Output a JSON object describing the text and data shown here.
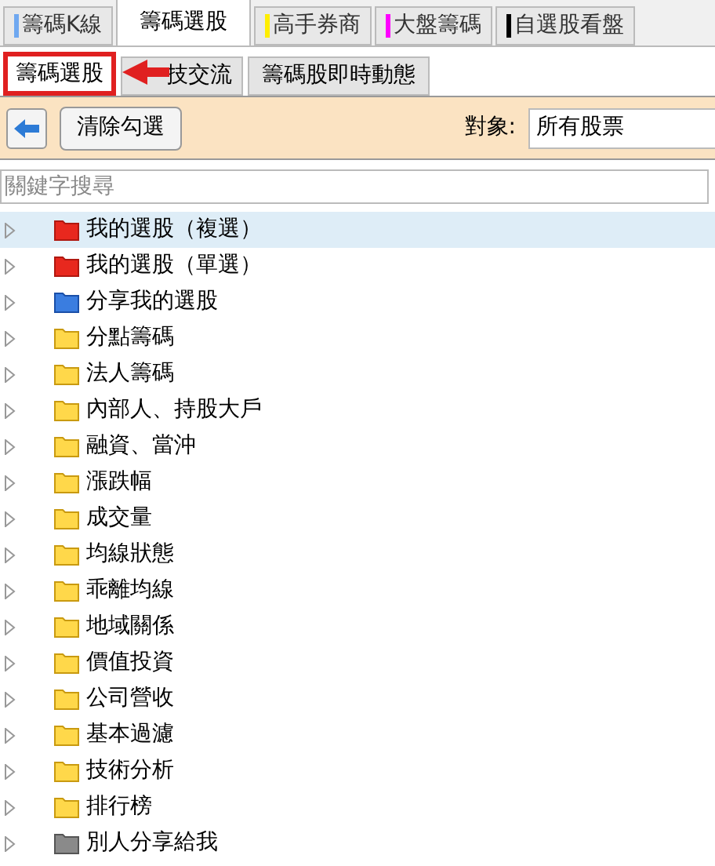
{
  "tabs": [
    {
      "label": "籌碼K線",
      "selected": false,
      "color": "#6fa8f0"
    },
    {
      "label": "籌碼選股",
      "selected": true
    },
    {
      "label": "高手券商",
      "selected": false,
      "color": "#ffee00"
    },
    {
      "label": "大盤籌碼",
      "selected": false,
      "color": "#ff00ff"
    },
    {
      "label": "自選股看盤",
      "selected": false,
      "color": "#000000"
    }
  ],
  "sub_tabs": [
    {
      "label": "籌碼選股",
      "selected": true
    },
    {
      "label": "技交流",
      "selected": false
    },
    {
      "label": "籌碼股即時動態",
      "selected": false
    }
  ],
  "toolbar": {
    "clear_button": "清除勾選",
    "target_label": "對象:",
    "target_value": "所有股票"
  },
  "search": {
    "placeholder": "關鍵字搜尋"
  },
  "tree": [
    {
      "label": "我的選股（複選）",
      "kind": "red",
      "selected": true
    },
    {
      "label": "我的選股（單選）",
      "kind": "red",
      "selected": false
    },
    {
      "label": "分享我的選股",
      "kind": "blue",
      "selected": false
    },
    {
      "label": "分點籌碼",
      "kind": "yellow",
      "selected": false
    },
    {
      "label": "法人籌碼",
      "kind": "yellow",
      "selected": false
    },
    {
      "label": "內部人、持股大戶",
      "kind": "yellow",
      "selected": false
    },
    {
      "label": "融資、當沖",
      "kind": "yellow",
      "selected": false
    },
    {
      "label": "漲跌幅",
      "kind": "yellow",
      "selected": false
    },
    {
      "label": "成交量",
      "kind": "yellow",
      "selected": false
    },
    {
      "label": "均線狀態",
      "kind": "yellow",
      "selected": false
    },
    {
      "label": "乖離均線",
      "kind": "yellow",
      "selected": false
    },
    {
      "label": "地域關係",
      "kind": "yellow",
      "selected": false
    },
    {
      "label": "價值投資",
      "kind": "yellow",
      "selected": false
    },
    {
      "label": "公司營收",
      "kind": "yellow",
      "selected": false
    },
    {
      "label": "基本過濾",
      "kind": "yellow",
      "selected": false
    },
    {
      "label": "技術分析",
      "kind": "yellow",
      "selected": false
    },
    {
      "label": "排行榜",
      "kind": "yellow",
      "selected": false
    },
    {
      "label": "別人分享給我",
      "kind": "gray",
      "selected": false
    }
  ]
}
